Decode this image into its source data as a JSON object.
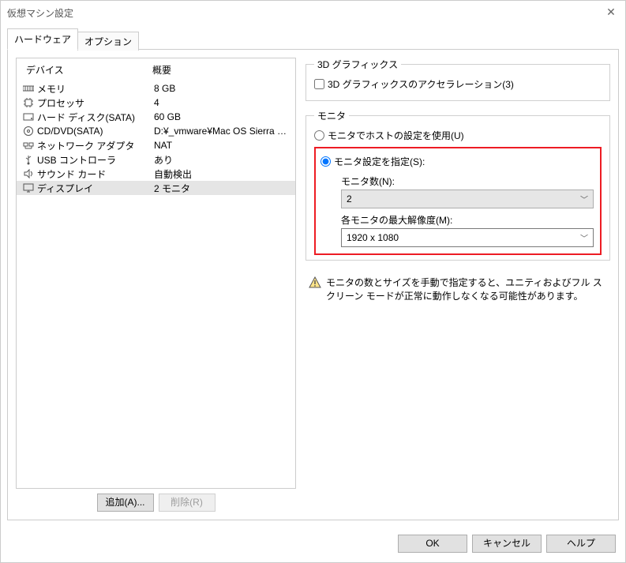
{
  "title": "仮想マシン設定",
  "tabs": {
    "hardware": "ハードウェア",
    "options": "オプション"
  },
  "columns": {
    "device": "デバイス",
    "summary": "概要"
  },
  "devices": [
    {
      "icon": "memory",
      "name": "メモリ",
      "summary": "8 GB"
    },
    {
      "icon": "cpu",
      "name": "プロセッサ",
      "summary": "4"
    },
    {
      "icon": "hdd",
      "name": "ハード ディスク(SATA)",
      "summary": "60 GB"
    },
    {
      "icon": "cd",
      "name": "CD/DVD(SATA)",
      "summary": "D:¥_vmware¥Mac OS Sierra 10..."
    },
    {
      "icon": "net",
      "name": "ネットワーク アダプタ",
      "summary": "NAT"
    },
    {
      "icon": "usb",
      "name": "USB コントローラ",
      "summary": "あり"
    },
    {
      "icon": "sound",
      "name": "サウンド カード",
      "summary": "自動検出"
    },
    {
      "icon": "display",
      "name": "ディスプレイ",
      "summary": "2 モニタ"
    }
  ],
  "left_buttons": {
    "add": "追加(A)...",
    "remove": "削除(R)"
  },
  "graphics3d": {
    "legend": "3D グラフィックス",
    "checkbox": "3D グラフィックスのアクセラレーション(3)"
  },
  "monitor": {
    "legend": "モニタ",
    "use_host": "モニタでホストの設定を使用(U)",
    "specify": "モニタ設定を指定(S):",
    "count_label": "モニタ数(N):",
    "count_value": "2",
    "max_res_label": "各モニタの最大解像度(M):",
    "max_res_value": "1920 x 1080"
  },
  "warning": "モニタの数とサイズを手動で指定すると、ユニティおよびフル スクリーン モードが正常に動作しなくなる可能性があります。",
  "buttons": {
    "ok": "OK",
    "cancel": "キャンセル",
    "help": "ヘルプ"
  }
}
